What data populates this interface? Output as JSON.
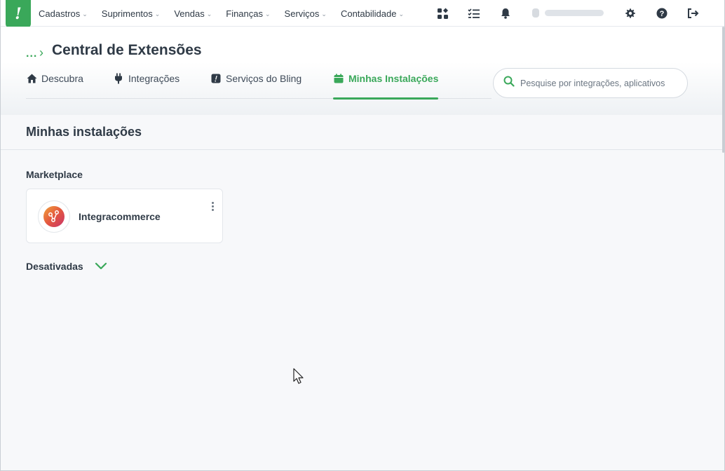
{
  "app": {
    "logo_text": "!",
    "brand_color": "#3aa85a"
  },
  "topnav": {
    "menu": [
      {
        "label": "Cadastros"
      },
      {
        "label": "Suprimentos"
      },
      {
        "label": "Vendas"
      },
      {
        "label": "Finanças"
      },
      {
        "label": "Serviços"
      },
      {
        "label": "Contabilidade"
      }
    ],
    "icons": [
      "apps-grid-icon",
      "tasks-list-icon",
      "bell-icon",
      "gear-icon",
      "help-icon",
      "logout-icon"
    ]
  },
  "breadcrumb": {
    "ellipsis": "...",
    "separator": "›"
  },
  "page": {
    "title": "Central de Extensões"
  },
  "tabs": [
    {
      "label": "Descubra",
      "icon": "home-icon"
    },
    {
      "label": "Integrações",
      "icon": "plug-icon"
    },
    {
      "label": "Serviços do Bling",
      "icon": "bling-icon"
    },
    {
      "label": "Minhas Instalações",
      "icon": "calendar-icon",
      "active": true
    }
  ],
  "search": {
    "placeholder": "Pesquise por integrações, aplicativos e"
  },
  "section": {
    "title": "Minhas instalações"
  },
  "groups": [
    {
      "label": "Marketplace",
      "items": [
        {
          "name": "Integracommerce",
          "icon": "integracommerce-logo-icon"
        }
      ]
    }
  ],
  "disabled": {
    "label": "Desativadas"
  }
}
